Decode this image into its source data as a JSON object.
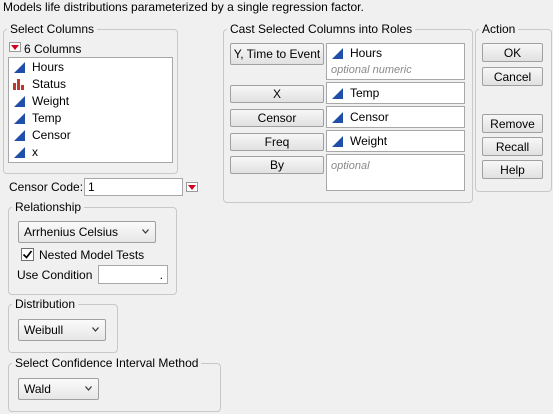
{
  "description": "Models life distributions parameterized by a single regression factor.",
  "select_columns": {
    "title": "Select Columns",
    "count_label": "6 Columns",
    "columns": [
      {
        "name": "Hours",
        "icon": "continuous-icon"
      },
      {
        "name": "Status",
        "icon": "nominal-icon"
      },
      {
        "name": "Weight",
        "icon": "continuous-icon"
      },
      {
        "name": "Temp",
        "icon": "continuous-icon"
      },
      {
        "name": "Censor",
        "icon": "continuous-icon"
      },
      {
        "name": "x",
        "icon": "continuous-icon"
      }
    ]
  },
  "roles": {
    "title": "Cast Selected Columns into Roles",
    "y_time": {
      "label": "Y, Time to Event",
      "value": "Hours",
      "hint": "optional numeric"
    },
    "x": {
      "label": "X",
      "value": "Temp"
    },
    "censor": {
      "label": "Censor",
      "value": "Censor"
    },
    "freq": {
      "label": "Freq",
      "value": "Weight"
    },
    "by": {
      "label": "By",
      "hint": "optional"
    }
  },
  "action": {
    "title": "Action",
    "ok": "OK",
    "cancel": "Cancel",
    "remove": "Remove",
    "recall": "Recall",
    "help": "Help"
  },
  "censor_code": {
    "label": "Censor Code:",
    "value": "1"
  },
  "relationship": {
    "title": "Relationship",
    "selected": "Arrhenius Celsius",
    "nested_label": "Nested Model Tests",
    "nested_checked": true,
    "use_condition_label": "Use Condition",
    "use_condition_value": "."
  },
  "distribution": {
    "title": "Distribution",
    "selected": "Weibull"
  },
  "ci_method": {
    "title": "Select Confidence Interval Method",
    "selected": "Wald"
  },
  "colors": {
    "continuous": "#1f4fa8",
    "nominal": "#c0392b",
    "red_menu": "#d0021b",
    "optional_text": "#8a8a8a"
  }
}
